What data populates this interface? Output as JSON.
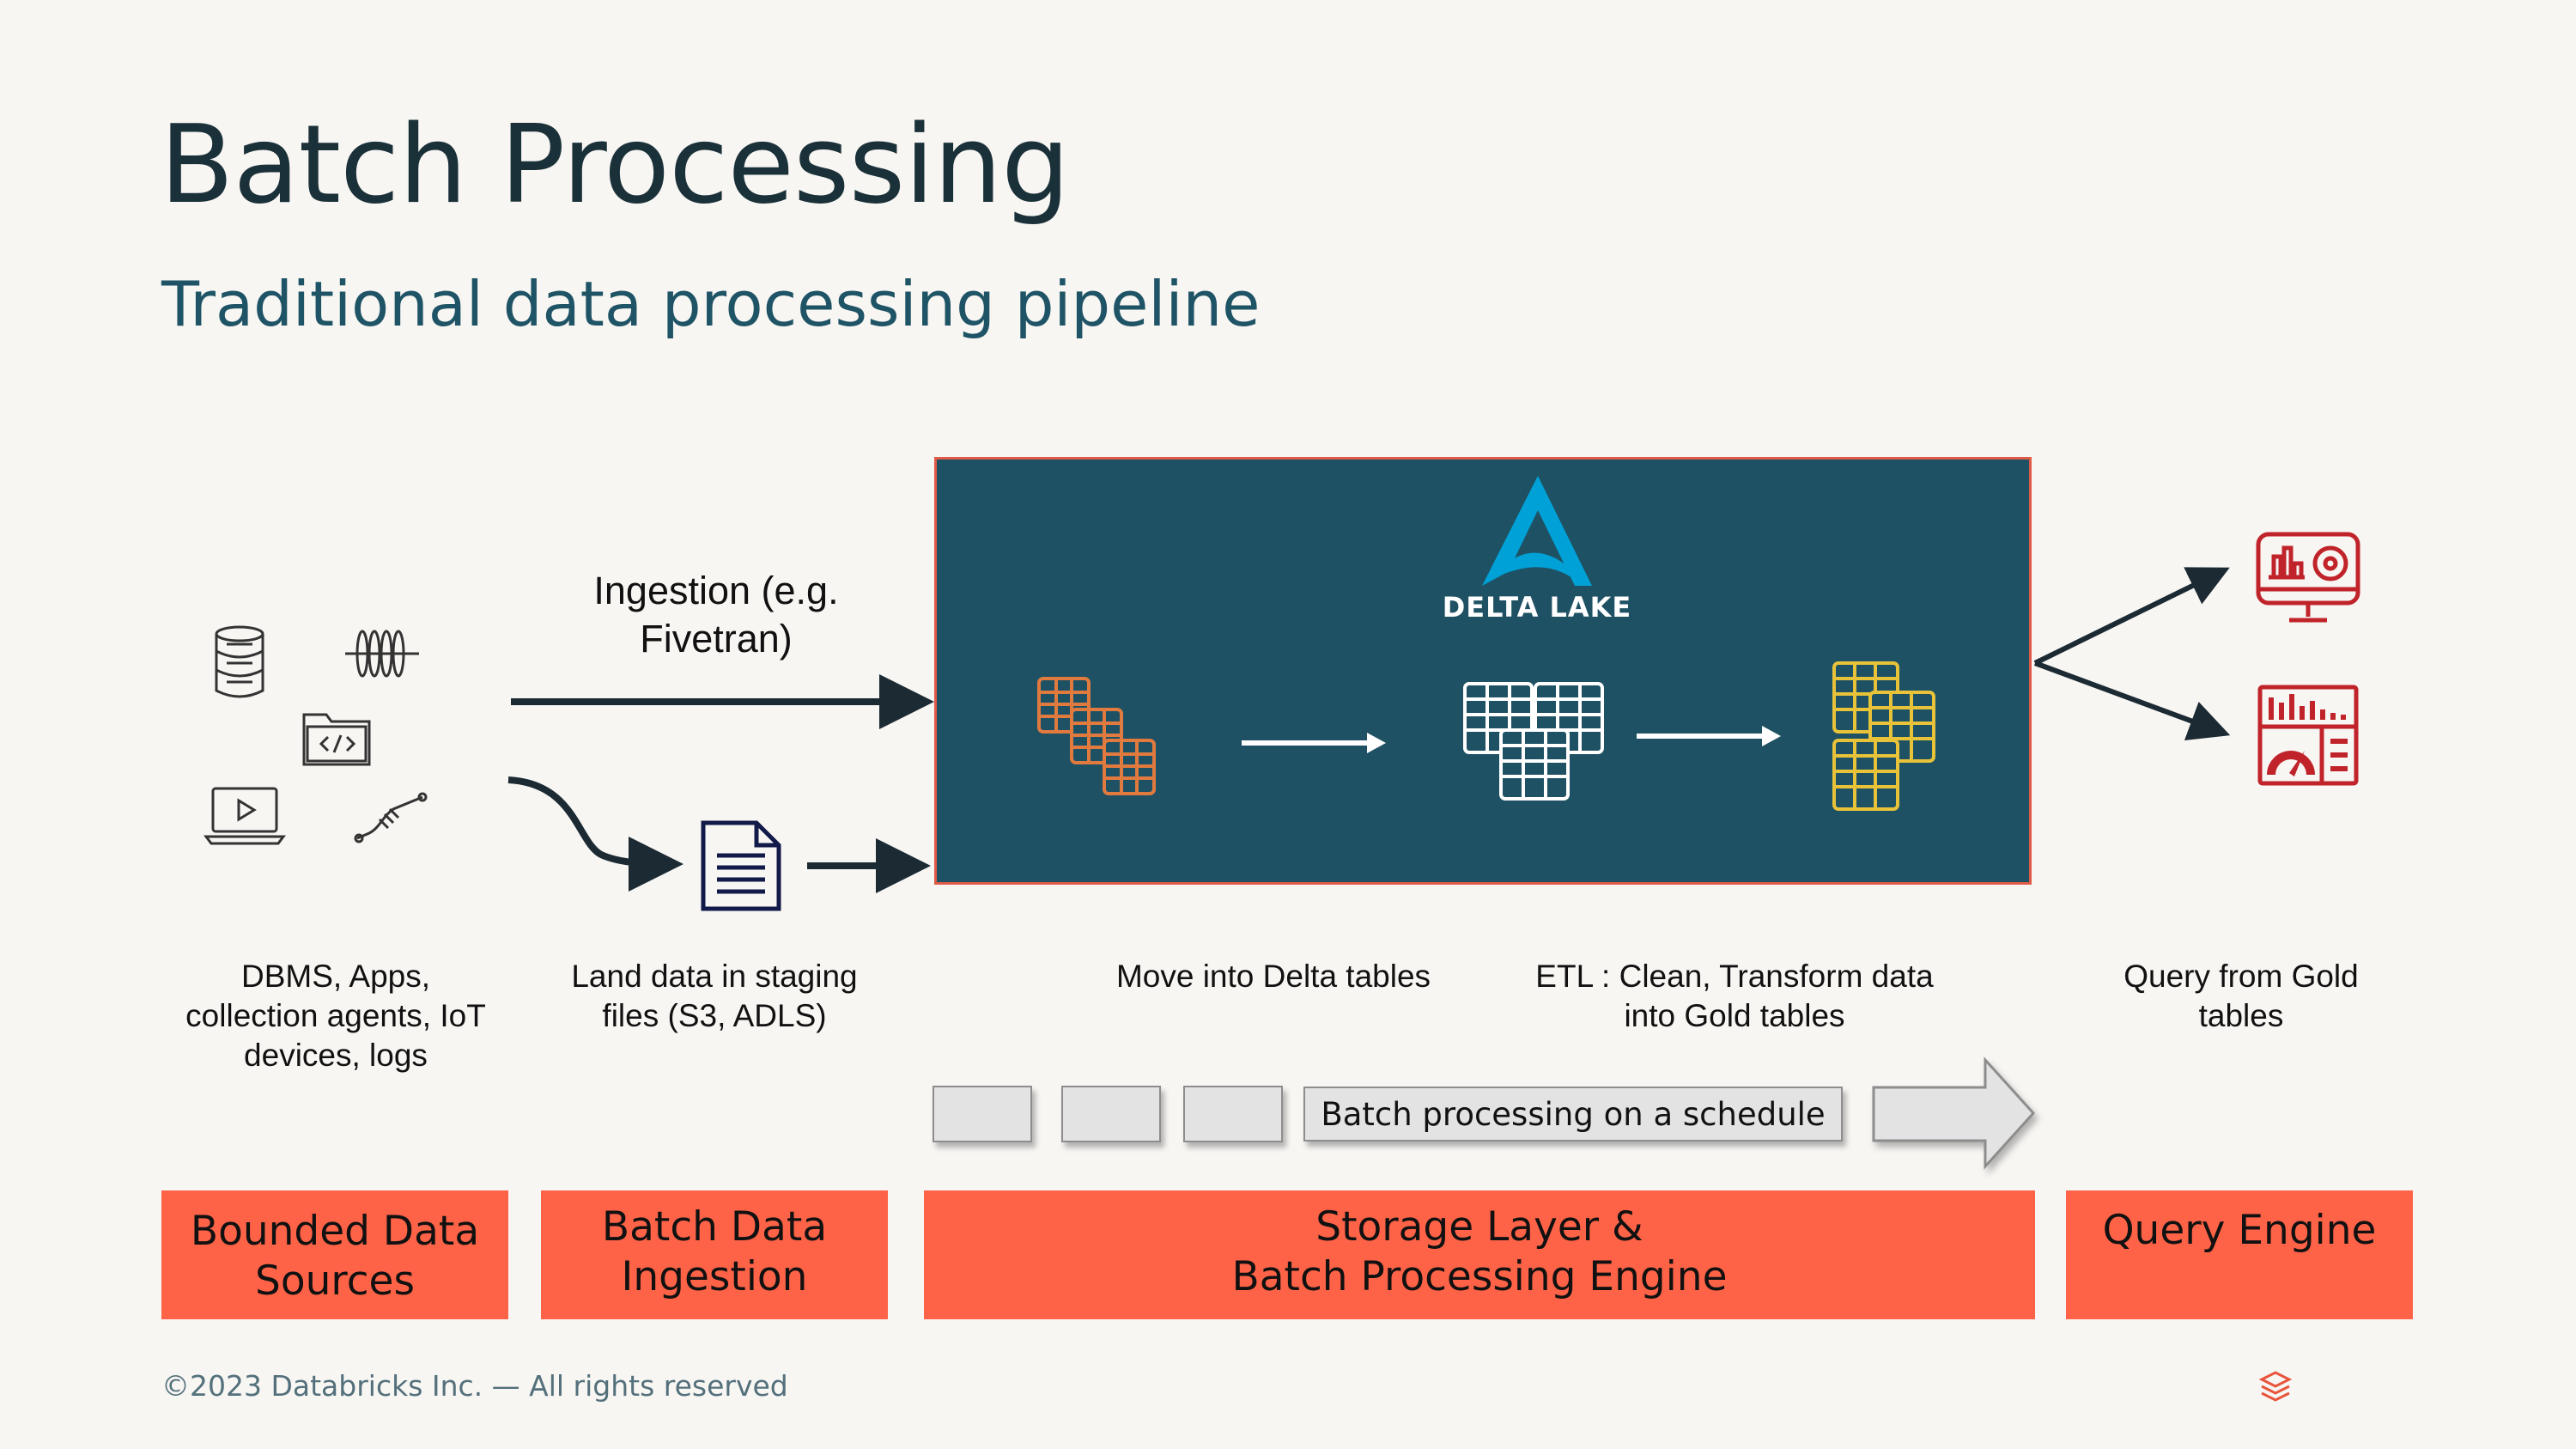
{
  "header": {
    "title": "Batch Processing",
    "subtitle": "Traditional data processing pipeline"
  },
  "ingestion_label": "Ingestion (e.g.\nFivetran)",
  "delta_lake": {
    "logo_text": "DELTA LAKE"
  },
  "stage_labels": {
    "sources": "DBMS, Apps,\ncollection agents, IoT\ndevices, logs",
    "staging": "Land data in staging\nfiles (S3, ADLS)",
    "delta": "Move into Delta tables",
    "etl": "ETL : Clean, Transform data\ninto Gold tables",
    "query": "Query from Gold\ntables"
  },
  "schedule": {
    "label": "Batch processing on a schedule"
  },
  "categories": [
    {
      "label": "Bounded Data\nSources"
    },
    {
      "label": "Batch Data\nIngestion"
    },
    {
      "label": "Storage Layer &\nBatch Processing Engine"
    },
    {
      "label": "Query Engine"
    }
  ],
  "footer": {
    "copyright": "©2023 Databricks Inc. — All rights reserved"
  },
  "icons": [
    "database-icon",
    "streaming-signal-icon",
    "code-folder-icon",
    "laptop-video-icon",
    "iot-cable-icon",
    "document-icon",
    "delta-lake-logo-icon",
    "bronze-tables-icon",
    "silver-tables-icon",
    "gold-tables-icon",
    "dashboard-monitor-icon",
    "report-chart-icon",
    "databricks-logo-icon"
  ],
  "colors": {
    "background": "#f8f6f3",
    "title": "#1b3139",
    "subtitle": "#1f5466",
    "panel": "#1e5163",
    "panel_border": "#e05a47",
    "category": "#fe6347",
    "bronze": "#e07a3f",
    "gold": "#e8c33a",
    "query_icons": "#c0242a",
    "delta_logo": "#00a1d6"
  }
}
